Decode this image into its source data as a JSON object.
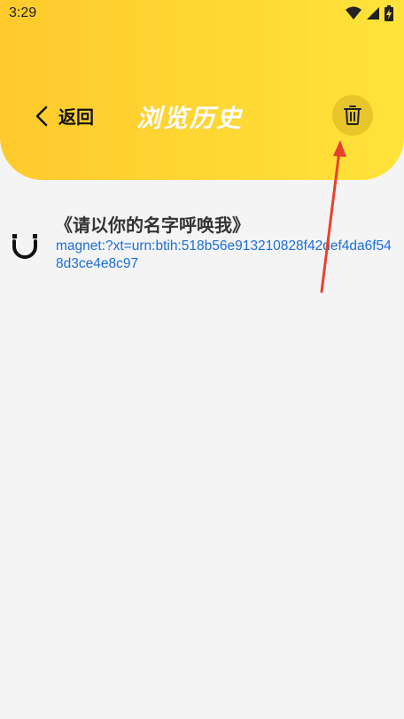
{
  "status_bar": {
    "time": "3:29",
    "icons": [
      "wifi-icon",
      "signal-icon",
      "battery-charging-icon"
    ]
  },
  "toolbar": {
    "back_label": "返回",
    "title": "浏览历史",
    "back_icon": "chevron-left-icon",
    "delete_icon": "trash-icon"
  },
  "history": {
    "items": [
      {
        "icon": "magnet-icon",
        "title": "《请以你的名字呼唤我》",
        "link": "magnet:?xt=urn:btih:518b56e913210828f42def4da6f548d3ce4e8c97"
      }
    ]
  },
  "colors": {
    "header_start": "#ffca2c",
    "header_end": "#ffe33a",
    "link": "#1a6ed8",
    "annotation": "#e8412c"
  }
}
